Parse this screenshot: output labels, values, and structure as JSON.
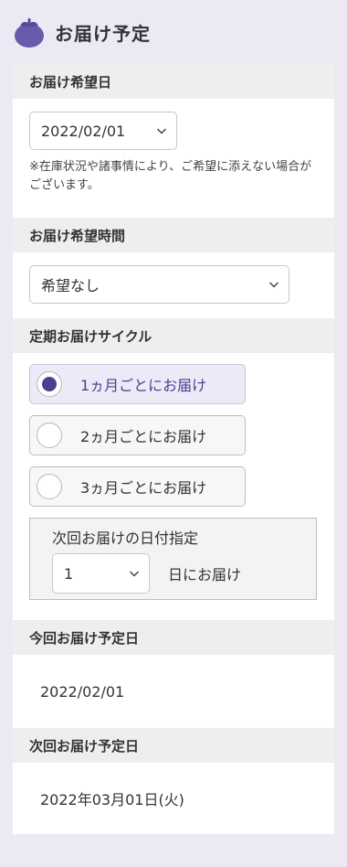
{
  "header": {
    "title": "お届け予定",
    "icon": "eggplant-icon",
    "icon_color": "#6a5aab"
  },
  "delivery_date": {
    "label": "お届け希望日",
    "value": "2022/02/01",
    "note": "※在庫状況や諸事情により、ご希望に添えない場合がございます。"
  },
  "delivery_time": {
    "label": "お届け希望時間",
    "value": "希望なし"
  },
  "cycle": {
    "label": "定期お届けサイクル",
    "options": [
      {
        "label": "1ヵ月ごとにお届け",
        "selected": true
      },
      {
        "label": "2ヵ月ごとにお届け",
        "selected": false
      },
      {
        "label": "3ヵ月ごとにお届け",
        "selected": false
      }
    ],
    "next_date": {
      "title": "次回お届けの日付指定",
      "value": "1",
      "suffix": "日にお届け"
    }
  },
  "current_scheduled": {
    "label": "今回お届け予定日",
    "value": "2022/02/01"
  },
  "next_scheduled": {
    "label": "次回お届け予定日",
    "value": "2022年03月01日(火)"
  },
  "colors": {
    "accent": "#4b3f91",
    "background": "#ebeaf4",
    "section_header": "#eeeeee"
  }
}
